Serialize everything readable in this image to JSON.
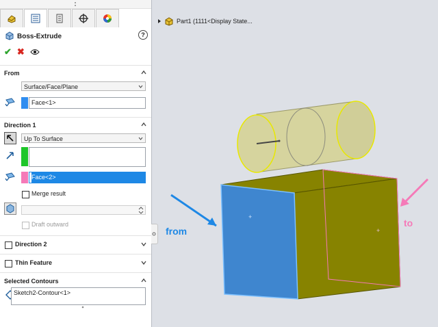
{
  "feature_tabs": [
    {
      "icon": "feature-manager-icon"
    },
    {
      "icon": "property-manager-icon"
    },
    {
      "icon": "configuration-manager-icon"
    },
    {
      "icon": "dimxpert-icon"
    },
    {
      "icon": "display-manager-icon"
    }
  ],
  "header": {
    "title": "Boss-Extrude",
    "help_label": "?"
  },
  "actions": {
    "ok": "✔",
    "cancel": "✖",
    "preview": "👁"
  },
  "from": {
    "title": "From",
    "type_value": "Surface/Face/Plane",
    "face_value": "Face<1>",
    "swatch_color": "#2f8df0"
  },
  "direction1": {
    "title": "Direction 1",
    "end_condition": "Up To Surface",
    "face_value": "Face<2>",
    "merge_label": "Merge result",
    "draft_label": "Draft outward",
    "swatch_green": "#1ec62a",
    "swatch_pink": "#f57ab8",
    "selected_bg": "#1e88e5"
  },
  "direction2": {
    "title": "Direction 2"
  },
  "thin_feature": {
    "title": "Thin Feature"
  },
  "selected_contours": {
    "title": "Selected Contours",
    "value": "Sketch2-Contour<1>"
  },
  "tree": {
    "label": "Part1  (1111<Display State..."
  },
  "annotations": {
    "from": "from",
    "to": "to",
    "from_color": "#1e88e5",
    "to_color": "#f57ab8"
  },
  "colors": {
    "blue_face": "#3f86cf",
    "olive": "#878300",
    "cylinder": "#d6d49e",
    "cylinder_edge": "#e8e800"
  }
}
